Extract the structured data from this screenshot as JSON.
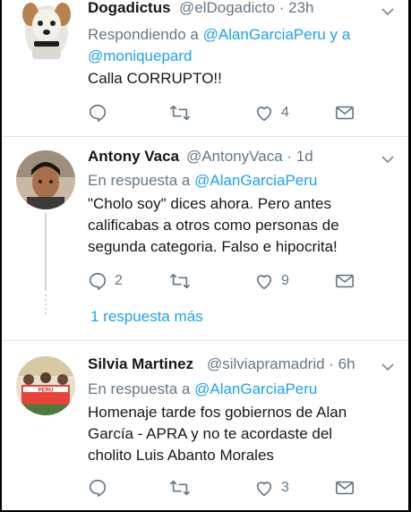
{
  "tweets": [
    {
      "name": "Dogadictus",
      "handle_time": "@elDogadicto · 23h",
      "reply_prefix": "Respondiendo a",
      "reply_mentions": "@AlanGarciaPeru y a",
      "reply_mentions_line2": "@moniquepard",
      "text_lines": [
        "Calla CORRUPTO!!"
      ],
      "likes": "4"
    },
    {
      "name": "Antony Vaca",
      "handle_time": "@AntonyVaca · 1d",
      "reply_prefix": "En respuesta a",
      "reply_mentions": "@AlanGarciaPeru",
      "text_lines": [
        "\"Cholo soy\" dices ahora. Pero antes",
        "calificabas a otros como personas de",
        "segunda  categoria. Falso e hipocrita!"
      ],
      "replies": "2",
      "likes": "9",
      "more_replies": "1 respuesta más"
    },
    {
      "name": "Silvia Martinez",
      "handle_time": "@silviapramadrid · 6h",
      "reply_prefix": "En respuesta a",
      "reply_mentions": "@AlanGarciaPeru",
      "text_lines": [
        "Homenaje tarde fos gobiernos de Alan",
        "García - APRA y no te acordaste del",
        "cholito Luis Abanto Morales"
      ],
      "likes": "3",
      "avatar_sign_text": "PERU"
    }
  ],
  "icons": {
    "reply": "reply-icon",
    "retweet": "retweet-icon",
    "like": "heart-icon",
    "dm": "envelope-icon",
    "more": "chevron-down-icon"
  },
  "colors": {
    "link": "#1da1f2",
    "secondary": "#657786",
    "divider": "#e1e8ed"
  }
}
